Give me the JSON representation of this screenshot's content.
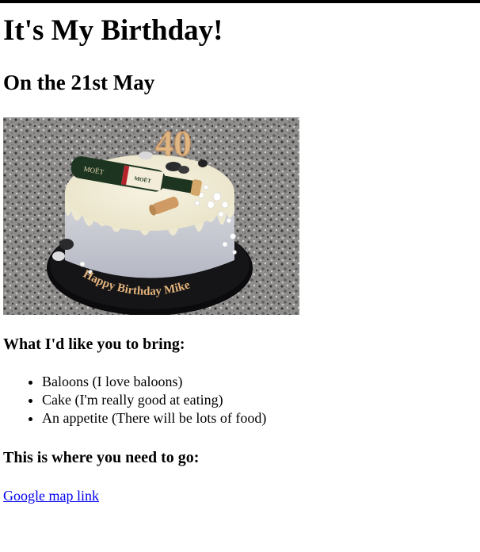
{
  "page": {
    "title": "It's My Birthday!",
    "date": "On the 21st May"
  },
  "cake_image": {
    "topper_number": "40",
    "bottle_label": "MOËT",
    "plate_text": "Happy Birthday Mike",
    "colors": {
      "granite": "#8c8a88",
      "frosting": "#f3efdc",
      "drip": "#ebe6cf",
      "cake_side": "#c9ccd6",
      "board": "#0b0b0d",
      "gold": "#d7a873",
      "bottle": "#1f3a22"
    }
  },
  "bring": {
    "heading": "What I'd like you to bring:",
    "items": [
      "Baloons (I love baloons)",
      "Cake (I'm really good at eating)",
      "An appetite (There will be lots of food)"
    ]
  },
  "location": {
    "heading": "This is where you need to go:",
    "link_text": "Google map link"
  }
}
